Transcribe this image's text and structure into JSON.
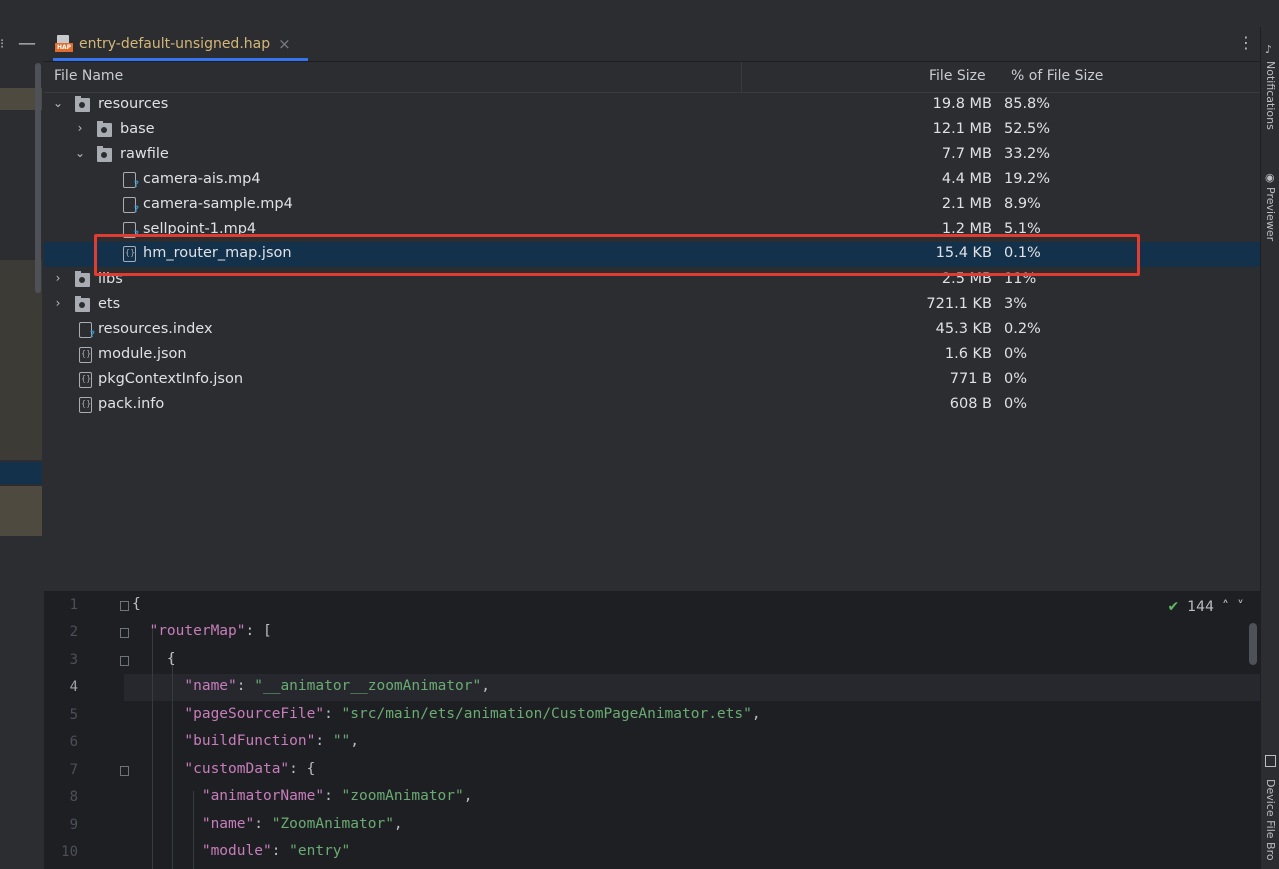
{
  "tab": {
    "title": "entry-default-unsigned.hap",
    "icon_text": "HAP"
  },
  "tree": {
    "columns": {
      "name": "File Name",
      "size": "File Size",
      "percent": "% of File Size"
    },
    "rows": [
      {
        "name": "resources",
        "size": "19.8 MB",
        "percent": "85.8%"
      },
      {
        "name": "base",
        "size": "12.1 MB",
        "percent": "52.5%"
      },
      {
        "name": "rawfile",
        "size": "7.7 MB",
        "percent": "33.2%"
      },
      {
        "name": "camera-ais.mp4",
        "size": "4.4 MB",
        "percent": "19.2%"
      },
      {
        "name": "camera-sample.mp4",
        "size": "2.1 MB",
        "percent": "8.9%"
      },
      {
        "name": "sellpoint-1.mp4",
        "size": "1.2 MB",
        "percent": "5.1%"
      },
      {
        "name": "hm_router_map.json",
        "size": "15.4 KB",
        "percent": "0.1%"
      },
      {
        "name": "libs",
        "size": "2.5 MB",
        "percent": "11%"
      },
      {
        "name": "ets",
        "size": "721.1 KB",
        "percent": "3%"
      },
      {
        "name": "resources.index",
        "size": "45.3 KB",
        "percent": "0.2%"
      },
      {
        "name": "module.json",
        "size": "1.6 KB",
        "percent": "0%"
      },
      {
        "name": "pkgContextInfo.json",
        "size": "771 B",
        "percent": "0%"
      },
      {
        "name": "pack.info",
        "size": "608 B",
        "percent": "0%"
      }
    ]
  },
  "right_tools": {
    "notifications": "Notifications",
    "previewer": "Previewer",
    "device_file": "Device File Bro"
  },
  "editor": {
    "inspection_count": "144",
    "lines": [
      {
        "num": "1",
        "t1": "{"
      },
      {
        "num": "2",
        "k": "\"routerMap\"",
        "p": ": ["
      },
      {
        "num": "3",
        "t1": "{"
      },
      {
        "num": "4",
        "k": "\"name\"",
        "p": ": ",
        "s": "\"__animator__zoomAnimator\"",
        "e": ","
      },
      {
        "num": "5",
        "k": "\"pageSourceFile\"",
        "p": ": ",
        "s": "\"src/main/ets/animation/CustomPageAnimator.ets\"",
        "e": ","
      },
      {
        "num": "6",
        "k": "\"buildFunction\"",
        "p": ": ",
        "s": "\"\"",
        "e": ","
      },
      {
        "num": "7",
        "k": "\"customData\"",
        "p": ": {"
      },
      {
        "num": "8",
        "k": "\"animatorName\"",
        "p": ": ",
        "s": "\"zoomAnimator\"",
        "e": ","
      },
      {
        "num": "9",
        "k": "\"name\"",
        "p": ": ",
        "s": "\"ZoomAnimator\"",
        "e": ","
      },
      {
        "num": "10",
        "k": "\"module\"",
        "p": ": ",
        "s": "\"entry\""
      }
    ]
  }
}
